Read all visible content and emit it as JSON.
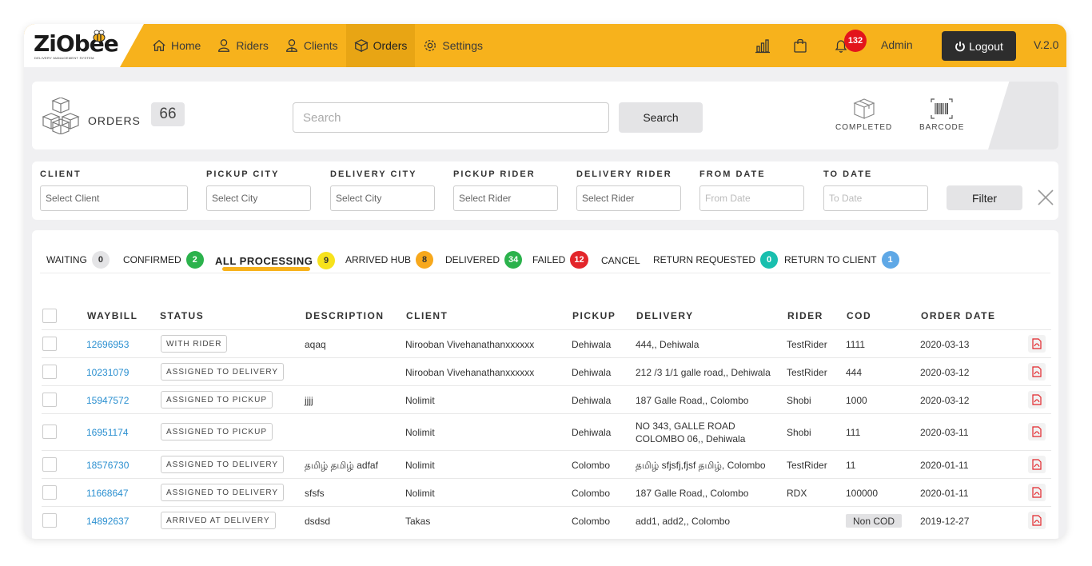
{
  "brand": {
    "logo_text": "ZiObee",
    "logo_sub": "DELIVERY MANAGEMENT SYSTEM"
  },
  "nav": [
    {
      "label": "Home",
      "icon": "home-icon"
    },
    {
      "label": "Riders",
      "icon": "user-icon"
    },
    {
      "label": "Clients",
      "icon": "users-icon"
    },
    {
      "label": "Orders",
      "icon": "box-icon",
      "active": true
    },
    {
      "label": "Settings",
      "icon": "gear-icon"
    }
  ],
  "header": {
    "notification_count": "132",
    "user": "Admin",
    "logout_label": "Logout",
    "version": "V.2.0"
  },
  "orders": {
    "title": "ORDERS",
    "count": "66",
    "search_placeholder": "Search",
    "search_button": "Search",
    "completed_label": "COMPLETED",
    "barcode_label": "BARCODE"
  },
  "filters": {
    "client": {
      "label": "CLIENT",
      "placeholder": "Select Client"
    },
    "pickup_city": {
      "label": "PICKUP CITY",
      "placeholder": "Select City"
    },
    "delivery_city": {
      "label": "DELIVERY CITY",
      "placeholder": "Select City"
    },
    "pickup_rider": {
      "label": "PICKUP RIDER",
      "placeholder": "Select Rider"
    },
    "delivery_rider": {
      "label": "DELIVERY RIDER",
      "placeholder": "Select Rider"
    },
    "from_date": {
      "label": "FROM DATE",
      "placeholder": "From Date"
    },
    "to_date": {
      "label": "TO DATE",
      "placeholder": "To Date"
    },
    "filter_button": "Filter"
  },
  "tabs": [
    {
      "label": "WAITING",
      "count": "0",
      "color": "#e4e4e6",
      "text_color": "#333"
    },
    {
      "label": "CONFIRMED",
      "count": "2",
      "color": "#2bb24c",
      "text_color": "#fff"
    },
    {
      "label": "ALL PROCESSING",
      "count": "9",
      "color": "#f7e21c",
      "text_color": "#333",
      "active": true
    },
    {
      "label": "ARRIVED HUB",
      "count": "8",
      "color": "#f7a81c",
      "text_color": "#333"
    },
    {
      "label": "DELIVERED",
      "count": "34",
      "color": "#2bb24c",
      "text_color": "#fff"
    },
    {
      "label": "FAILED",
      "count": "12",
      "color": "#e3262b",
      "text_color": "#fff"
    },
    {
      "label": "CANCEL",
      "count": "",
      "color": "",
      "text_color": ""
    },
    {
      "label": "RETURN REQUESTED",
      "count": "0",
      "color": "#19bfae",
      "text_color": "#fff"
    },
    {
      "label": "RETURN TO CLIENT",
      "count": "1",
      "color": "#5fa8e6",
      "text_color": "#fff"
    }
  ],
  "table": {
    "columns": [
      "WAYBILL",
      "STATUS",
      "DESCRIPTION",
      "CLIENT",
      "PICKUP",
      "DELIVERY",
      "RIDER",
      "COD",
      "ORDER DATE"
    ],
    "rows": [
      {
        "waybill": "12696953",
        "status": "WITH RIDER",
        "description": "aqaq",
        "client": "Nirooban Vivehanathanxxxxxx",
        "pickup": "Dehiwala",
        "delivery": "444,, Dehiwala",
        "rider": "TestRider",
        "cod": "1111",
        "date": "2020-03-13"
      },
      {
        "waybill": "10231079",
        "status": "ASSIGNED TO DELIVERY",
        "description": "",
        "client": "Nirooban Vivehanathanxxxxxx",
        "pickup": "Dehiwala",
        "delivery": "212 /3 1/1 galle road,, Dehiwala",
        "rider": "TestRider",
        "cod": "444",
        "date": "2020-03-12"
      },
      {
        "waybill": "15947572",
        "status": "ASSIGNED TO PICKUP",
        "description": "jjjj",
        "client": "Nolimit",
        "pickup": "Dehiwala",
        "delivery": "187 Galle Road,, Colombo",
        "rider": "Shobi",
        "cod": "1000",
        "date": "2020-03-12"
      },
      {
        "waybill": "16951174",
        "status": "ASSIGNED TO PICKUP",
        "description": "",
        "client": "Nolimit",
        "pickup": "Dehiwala",
        "delivery": "NO 343, GALLE ROAD COLOMBO 06,, Dehiwala",
        "rider": "Shobi",
        "cod": "111",
        "date": "2020-03-11"
      },
      {
        "waybill": "18576730",
        "status": "ASSIGNED TO DELIVERY",
        "description": "தமிழ் தமிழ் adfaf",
        "client": "Nolimit",
        "pickup": "Colombo",
        "delivery": "தமிழ் sfjsfj,fjsf தமிழ், Colombo",
        "rider": "TestRider",
        "cod": "11",
        "date": "2020-01-11"
      },
      {
        "waybill": "11668647",
        "status": "ASSIGNED TO DELIVERY",
        "description": "sfsfs",
        "client": "Nolimit",
        "pickup": "Colombo",
        "delivery": "187 Galle Road,, Colombo",
        "rider": "RDX",
        "cod": "100000",
        "date": "2020-01-11"
      },
      {
        "waybill": "14892637",
        "status": "ARRIVED AT DELIVERY",
        "description": "dsdsd",
        "client": "Takas",
        "pickup": "Colombo",
        "delivery": "add1, add2,, Colombo",
        "rider": "",
        "cod": "Non COD",
        "date": "2019-12-27"
      }
    ]
  }
}
